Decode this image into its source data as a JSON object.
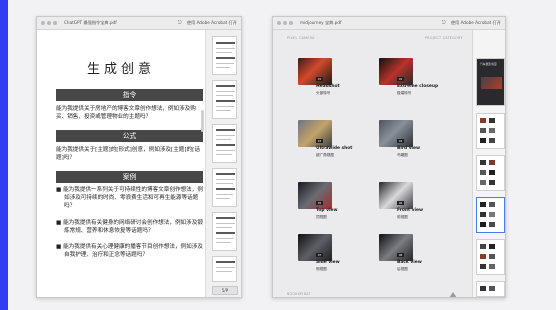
{
  "left_window": {
    "title": "ChatGPT 最强指令宝典.pdf",
    "open_with": "使用 Adobe Acrobat 打开",
    "doc_title": "生成创意",
    "sections": [
      {
        "header": "指令",
        "text": "能为我提供关于房地产的博客文章创作想法，例如涉及购买、销售、投资或管理物业的主题吗？"
      },
      {
        "header": "公式",
        "text": "能为我提供关于[主题]的[形式]创意，例如涉及[主题]的[话题]吗？"
      },
      {
        "header": "案例",
        "bullets": [
          "能为我提供一系列关于可持续性的博客文章创作想法，例如涉及可持续的时尚、零浪费生活和可再生能源等话题吗？",
          "能为我提供有关健身的网络研讨会创作想法，例如涉及锻炼常规、营养和休息恢复等话题吗？",
          "能为我提供有关心理健康的播客节目创作想法，例如涉及自我护理、治疗和正念等话题吗？"
        ]
      }
    ],
    "page_button": "5/P"
  },
  "right_window": {
    "title": "midjourney 宝典.pdf",
    "open_with": "使用 Adobe Acrobat 打开",
    "header_left": "PIXEL CAMERA",
    "header_right": "PROJECT CATEGORY",
    "footer_left": "BOOKSPIRAT",
    "cards": [
      {
        "tag": "01",
        "en": "Headshot",
        "cn": "头部特写"
      },
      {
        "tag": "02",
        "en": "Extreme closeup",
        "cn": "极端特写"
      },
      {
        "tag": "03",
        "en": "Ultrawide shot",
        "cn": "超广角视图"
      },
      {
        "tag": "04",
        "en": "Bird view",
        "cn": "鸟瞰图"
      },
      {
        "tag": "05",
        "en": "Top view",
        "cn": "顶视图"
      },
      {
        "tag": "06",
        "en": "Front view",
        "cn": "前视图"
      },
      {
        "tag": "07",
        "en": "Side view",
        "cn": "侧视图"
      },
      {
        "tag": "08",
        "en": "Back view",
        "cn": "后视图"
      }
    ],
    "rail_header": "汽车摄影角度"
  },
  "colors": {
    "accent_bar": "#2f3cf0",
    "band": "#474747",
    "selection": "#4a7ee0"
  }
}
